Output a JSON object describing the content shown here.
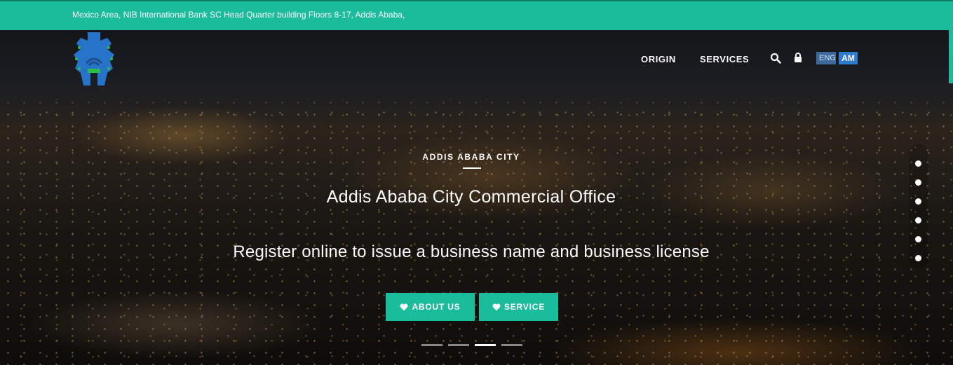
{
  "topbar": {
    "address": "Mexico Area, NIB International Bank SC Head Quarter building Floors 8-17, Addis Ababa,",
    "background_color": "#1abc9c"
  },
  "header": {
    "logo_icon": "city-gate-logo",
    "nav": [
      {
        "label": "ORIGIN"
      },
      {
        "label": "SERVICES"
      }
    ],
    "search_icon": "search-icon",
    "lock_icon": "lock-icon",
    "languages": [
      {
        "label": "ENG",
        "active": false
      },
      {
        "label": "AM",
        "active": true
      }
    ]
  },
  "hero": {
    "eyebrow": "ADDIS ABABA CITY",
    "title": "Addis Ababa City Commercial Office",
    "subtitle": "Register online to issue a business name and business license",
    "buttons": [
      {
        "label": "ABOUT US",
        "icon": "heart-icon"
      },
      {
        "label": "SERVICE",
        "icon": "heart-icon"
      }
    ],
    "accent_color": "#1abc9c"
  },
  "slider": {
    "section_dots": 6,
    "slide_count": 4,
    "active_slide": 3
  }
}
